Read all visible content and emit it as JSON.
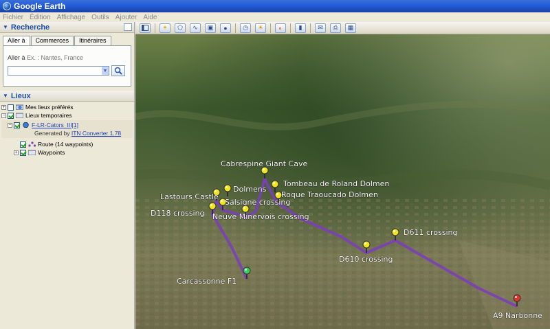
{
  "window": {
    "title": "Google Earth"
  },
  "menu": [
    "Fichier",
    "Édition",
    "Affichage",
    "Outils",
    "Ajouter",
    "Aide"
  ],
  "search": {
    "header": "Recherche",
    "tabs": [
      "Aller à",
      "Commerces",
      "Itinéraires"
    ],
    "active_tab": "Aller à",
    "hint_label": "Aller à",
    "hint_example": "Ex. : Nantes, France",
    "input_value": ""
  },
  "places": {
    "header": "Lieux",
    "items": [
      {
        "label": "Mes lieux préférés"
      },
      {
        "label": "Lieux temporaires"
      },
      {
        "label": "F-LR-Cators_III[1]"
      },
      {
        "generated_prefix": "Generated by ",
        "generated_link": "ITN Converter 1.78"
      },
      {
        "label": "Route (14 waypoints)"
      },
      {
        "label": "Waypoints"
      }
    ]
  },
  "toolbar": {
    "buttons": [
      "sidebar-toggle",
      "placemark",
      "polygon",
      "path",
      "image-overlay",
      "record-tour",
      "historical-imagery",
      "sunlight",
      "planets",
      "ruler",
      "email",
      "print",
      "google-maps"
    ]
  },
  "map": {
    "waypoints": [
      {
        "name": "Cabrespine Giant Cave",
        "color": "#f2e51b"
      },
      {
        "name": "Tombeau de Roland Dolmen",
        "color": "#f2e51b"
      },
      {
        "name": "Dolmens",
        "color": "#f2e51b"
      },
      {
        "name": "Roque Traoucado Dolmen",
        "color": "#f2e51b"
      },
      {
        "name": "Lastours Castle",
        "color": "#f2e51b"
      },
      {
        "name": "Salsigne crossing",
        "color": "#f2e51b"
      },
      {
        "name": "D118 crossing",
        "color": "#f2e51b"
      },
      {
        "name": "Neuve Minervois crossing",
        "color": "#f2e51b"
      },
      {
        "name": "D611 crossing",
        "color": "#f2e51b"
      },
      {
        "name": "D610 crossing",
        "color": "#f2e51b"
      },
      {
        "name": "Carcassonne F1",
        "color": "#37d05a"
      },
      {
        "name": "A9 Narbonne",
        "color": "#e0332a"
      }
    ],
    "route_color": "#7b3fb8"
  }
}
